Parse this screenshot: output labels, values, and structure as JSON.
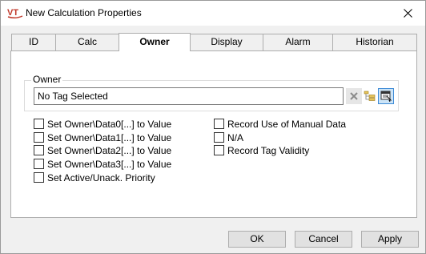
{
  "window": {
    "title": "New Calculation Properties",
    "app_icon": "vt-logo-icon",
    "accent_color": "#c0392b"
  },
  "tabs": [
    {
      "label": "ID",
      "active": false
    },
    {
      "label": "Calc",
      "active": false
    },
    {
      "label": "Owner",
      "active": true
    },
    {
      "label": "Display",
      "active": false
    },
    {
      "label": "Alarm",
      "active": false
    },
    {
      "label": "Historian",
      "active": false
    }
  ],
  "owner_group": {
    "legend": "Owner",
    "tag_value": "No Tag Selected",
    "buttons": {
      "clear_icon": "clear-x-icon",
      "browse_icon": "tree-browse-icon",
      "pick_icon": "tag-picker-icon"
    }
  },
  "checkboxes_left": [
    {
      "label": "Set Owner\\Data0[...] to Value",
      "checked": false
    },
    {
      "label": "Set Owner\\Data1[...] to Value",
      "checked": false
    },
    {
      "label": "Set Owner\\Data2[...] to Value",
      "checked": false
    },
    {
      "label": "Set Owner\\Data3[...] to Value",
      "checked": false
    },
    {
      "label": "Set Active/Unack. Priority",
      "checked": false
    }
  ],
  "checkboxes_right": [
    {
      "label": "Record Use of Manual Data",
      "checked": false
    },
    {
      "label": "N/A",
      "checked": false
    },
    {
      "label": "Record Tag Validity",
      "checked": false
    }
  ],
  "footer": {
    "ok_label": "OK",
    "cancel_label": "Cancel",
    "apply_label": "Apply"
  }
}
